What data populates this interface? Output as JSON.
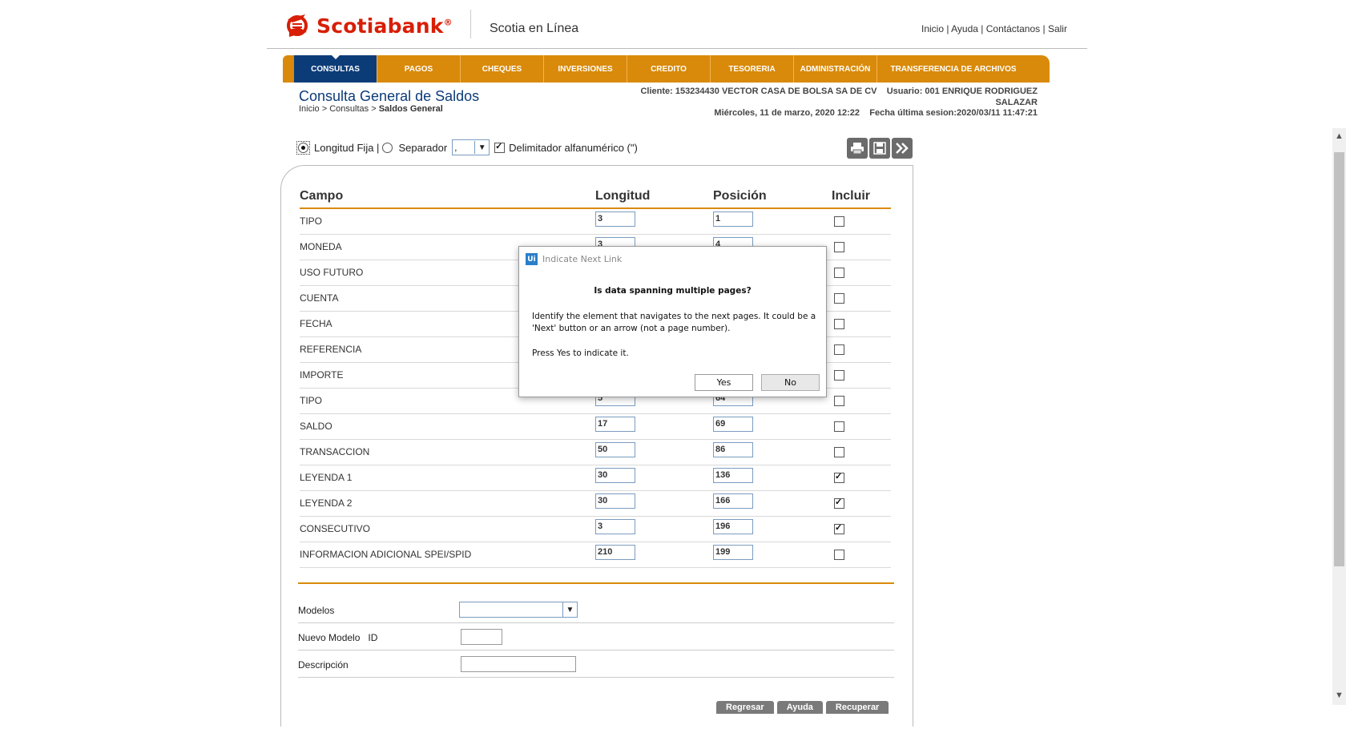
{
  "header": {
    "brand": "Scotiabank",
    "app_name": "Scotia en Línea",
    "links": [
      "Inicio",
      "Ayuda",
      "Contáctanos",
      "Salir"
    ]
  },
  "nav": {
    "tabs": [
      {
        "label": "CONSULTAS",
        "active": true
      },
      {
        "label": "PAGOS"
      },
      {
        "label": "CHEQUES"
      },
      {
        "label": "INVERSIONES"
      },
      {
        "label": "CREDITO"
      },
      {
        "label": "TESORERIA"
      },
      {
        "label": "ADMINISTRACIÓN"
      },
      {
        "label": "TRANSFERENCIA DE ARCHIVOS"
      }
    ]
  },
  "page": {
    "title": "Consulta General de Saldos",
    "breadcrumb": {
      "inicio": "Inicio",
      "consultas": "Consultas",
      "current": "Saldos General"
    },
    "client": "Cliente: 153234430 VECTOR CASA DE BOLSA SA DE CV",
    "usuario": "Usuario: 001 ENRIQUE RODRIGUEZ",
    "usuario_2": "SALAZAR",
    "fecha": "Miércoles, 11 de marzo, 2020 12:22",
    "ultima_sesion": "Fecha última sesion:2020/03/11 11:47:21"
  },
  "options": {
    "longitud_fija": "Longitud Fija |",
    "separador": "Separador",
    "separador_value": ",",
    "delimitador": "Delimitador alfanumérico (\")"
  },
  "grid": {
    "headers": {
      "campo": "Campo",
      "longitud": "Longitud",
      "posicion": "Posición",
      "incluir": "Incluir"
    },
    "rows": [
      {
        "campo": "TIPO",
        "longitud": "3",
        "posicion": "1",
        "incluir": false
      },
      {
        "campo": "MONEDA",
        "longitud": "3",
        "posicion": "4",
        "incluir": false
      },
      {
        "campo": "USO FUTURO",
        "longitud": "",
        "posicion": "",
        "incluir": false
      },
      {
        "campo": "CUENTA",
        "longitud": "",
        "posicion": "",
        "incluir": false
      },
      {
        "campo": "FECHA",
        "longitud": "",
        "posicion": "",
        "incluir": false
      },
      {
        "campo": "REFERENCIA",
        "longitud": "",
        "posicion": "",
        "incluir": false
      },
      {
        "campo": "IMPORTE",
        "longitud": "",
        "posicion": "",
        "incluir": false
      },
      {
        "campo": "TIPO",
        "longitud": "5",
        "posicion": "64",
        "incluir": false
      },
      {
        "campo": "SALDO",
        "longitud": "17",
        "posicion": "69",
        "incluir": false
      },
      {
        "campo": "TRANSACCION",
        "longitud": "50",
        "posicion": "86",
        "incluir": false
      },
      {
        "campo": "LEYENDA 1",
        "longitud": "30",
        "posicion": "136",
        "incluir": true
      },
      {
        "campo": "LEYENDA 2",
        "longitud": "30",
        "posicion": "166",
        "incluir": true
      },
      {
        "campo": "CONSECUTIVO",
        "longitud": "3",
        "posicion": "196",
        "incluir": true
      },
      {
        "campo": "INFORMACION ADICIONAL SPEI/SPID",
        "longitud": "210",
        "posicion": "199",
        "incluir": false
      }
    ]
  },
  "form": {
    "modelos": "Modelos",
    "nuevo_modelo": "Nuevo Modelo",
    "id": "ID",
    "descripcion": "Descripción"
  },
  "buttons": {
    "regresar": "Regresar",
    "ayuda": "Ayuda",
    "recuperar": "Recuperar"
  },
  "dialog": {
    "logo": "Ui",
    "title": "Indicate Next Link",
    "heading": "Is data spanning multiple pages?",
    "body": "Identify the element that navigates to the next pages. It could be a 'Next' button or an arrow (not a page number).",
    "press": "Press Yes to indicate it.",
    "yes": "Yes",
    "no": "No"
  },
  "colors": {
    "brand_red": "#d81e05",
    "nav_orange": "#d98a0a",
    "nav_active": "#0c3c78"
  }
}
